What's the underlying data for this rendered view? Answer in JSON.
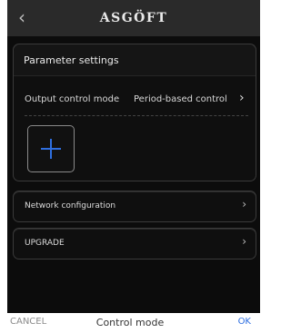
{
  "header": {
    "back_icon": "chevron-left-icon",
    "back_glyph": "‹",
    "brand": "ASGÖFT"
  },
  "parameter_card": {
    "title": "Parameter settings",
    "row": {
      "label": "Output control mode",
      "value": "Period-based control",
      "chevron_icon": "chevron-right-icon",
      "chevron_glyph": "›"
    },
    "add_button_icon": "plus-icon"
  },
  "menu_items": [
    {
      "label": "Network configuration",
      "chevron_icon": "chevron-right-icon",
      "chevron_glyph": "›"
    },
    {
      "label": "UPGRADE",
      "chevron_icon": "chevron-right-icon",
      "chevron_glyph": "›"
    }
  ],
  "footer": {
    "cancel_label": "CANCEL",
    "title": "Control mode",
    "ok_label": "OK"
  },
  "colors": {
    "accent": "#2f6fe0",
    "background": "#0c0c0c",
    "header": "#2a2a2a"
  }
}
